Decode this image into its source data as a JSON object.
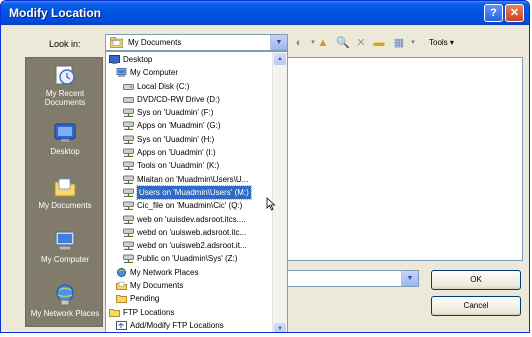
{
  "window": {
    "title": "Modify Location",
    "help_glyph": "?",
    "close_glyph": "✕"
  },
  "look_in": {
    "label": "Look in:",
    "value": "My Documents"
  },
  "toolbar": {
    "tools_label": "Tools ▾"
  },
  "places": [
    {
      "label": "My Recent Documents",
      "icon": "recent-docs-icon"
    },
    {
      "label": "Desktop",
      "icon": "desktop-icon"
    },
    {
      "label": "My Documents",
      "icon": "my-documents-icon"
    },
    {
      "label": "My Computer",
      "icon": "my-computer-icon"
    },
    {
      "label": "My Network Places",
      "icon": "network-places-icon"
    }
  ],
  "dropdown_items": [
    {
      "label": "Desktop",
      "indent": 0,
      "icon": "desktop"
    },
    {
      "label": "My Computer",
      "indent": 1,
      "icon": "computer"
    },
    {
      "label": "Local Disk (C:)",
      "indent": 2,
      "icon": "disk"
    },
    {
      "label": "DVD/CD-RW Drive (D:)",
      "indent": 2,
      "icon": "cd"
    },
    {
      "label": "Sys on 'Uuadmin' (F:)",
      "indent": 2,
      "icon": "net"
    },
    {
      "label": "Apps on 'Muadmin' (G:)",
      "indent": 2,
      "icon": "net"
    },
    {
      "label": "Sys on 'Uuadmin' (H:)",
      "indent": 2,
      "icon": "net"
    },
    {
      "label": "Apps on 'Uuadmin' (I:)",
      "indent": 2,
      "icon": "net"
    },
    {
      "label": "Tools on 'Uuadmin' (K:)",
      "indent": 2,
      "icon": "net"
    },
    {
      "label": "Mlaitan on 'Muadmin\\Users\\U...",
      "indent": 2,
      "icon": "net"
    },
    {
      "label": "Users on 'Muadmin\\Users' (M:)",
      "indent": 2,
      "icon": "net",
      "selected": true
    },
    {
      "label": "Cic_file on 'Muadmin\\Cic' (Q:)",
      "indent": 2,
      "icon": "net"
    },
    {
      "label": "web on 'uuisdev.adsroot.itcs....",
      "indent": 2,
      "icon": "net"
    },
    {
      "label": "webd on 'uuisweb.adsroot.itc...",
      "indent": 2,
      "icon": "net"
    },
    {
      "label": "webd on 'uuisweb2.adsroot.it...",
      "indent": 2,
      "icon": "net"
    },
    {
      "label": "Public on 'Uuadmin\\Sys' (Z:)",
      "indent": 2,
      "icon": "net"
    },
    {
      "label": "My Network Places",
      "indent": 1,
      "icon": "network"
    },
    {
      "label": "My Documents",
      "indent": 1,
      "icon": "docs"
    },
    {
      "label": "Pending",
      "indent": 1,
      "icon": "folder"
    },
    {
      "label": "FTP Locations",
      "indent": 0,
      "icon": "folder"
    },
    {
      "label": "Add/Modify FTP Locations",
      "indent": 1,
      "icon": "ftp"
    }
  ],
  "buttons": {
    "ok": "OK",
    "cancel": "Cancel"
  },
  "colors": {
    "title_bar": "#0054e3",
    "selection": "#316ac5",
    "places_bar": "#807b6b",
    "dialog_bg": "#ece9d8"
  }
}
